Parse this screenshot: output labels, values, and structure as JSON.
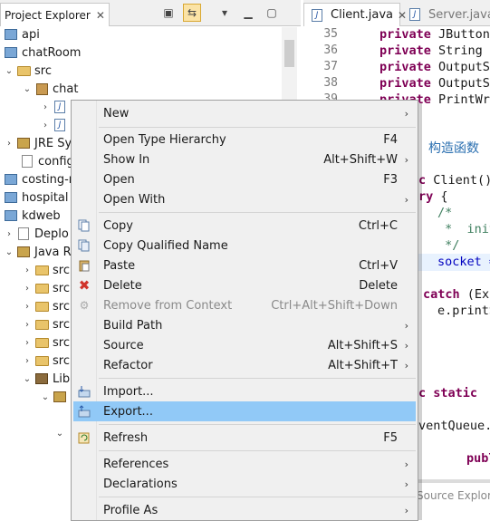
{
  "project_explorer": {
    "title": "Project Explorer",
    "close_glyph": "✕",
    "toolbar_icons": [
      "collapse-all-icon",
      "link-with-editor-icon",
      "view-menu-icon",
      "minimize-icon",
      "maximize-icon"
    ],
    "tree": [
      {
        "label": "api",
        "icon": "project-icon"
      },
      {
        "label": "chatRoom",
        "icon": "project-icon"
      },
      {
        "label": "src",
        "icon": "source-folder-icon"
      },
      {
        "label": "chat",
        "icon": "package-icon"
      },
      {
        "label": "J",
        "icon": "java-file-icon"
      },
      {
        "label": "J",
        "icon": "java-file-icon"
      },
      {
        "label": "JRE Sy",
        "icon": "jre-library-icon"
      },
      {
        "label": "config",
        "icon": "file-icon"
      },
      {
        "label": "costing-m",
        "icon": "project-icon"
      },
      {
        "label": "hospital",
        "icon": "project-icon"
      },
      {
        "label": "kdweb",
        "icon": "project-icon"
      },
      {
        "label": "Deplo",
        "icon": "deployment-icon"
      },
      {
        "label": "Java R",
        "icon": "java-resources-icon"
      },
      {
        "label": "src",
        "icon": "source-folder-icon"
      },
      {
        "label": "src",
        "icon": "source-folder-icon"
      },
      {
        "label": "src",
        "icon": "source-folder-icon"
      },
      {
        "label": "src",
        "icon": "source-folder-icon"
      },
      {
        "label": "src",
        "icon": "source-folder-icon"
      },
      {
        "label": "src",
        "icon": "source-folder-icon"
      },
      {
        "label": "Lib",
        "icon": "library-icon"
      }
    ]
  },
  "editor": {
    "tabs": [
      {
        "label": "Client.java",
        "active": true
      },
      {
        "label": "Server.java",
        "active": false
      }
    ],
    "line_numbers": [
      "35",
      "36",
      "37",
      "38",
      "39"
    ],
    "code": {
      "l35_kw": "private",
      "l35_rest": " JButton",
      "l36_kw": "private",
      "l36_rest": " String ",
      "l37_kw": "private",
      "l37_rest": " OutputS",
      "l38_kw": "private",
      "l38_rest": " OutputS",
      "l39_kw": "private",
      "l39_rest": " PrintWr",
      "comment_cn": "构造函数",
      "client_kw": "c",
      "client_rest": " Client()",
      "try_kw": "ry",
      "try_rest": " {",
      "c1": "/*",
      "c2": " *  init",
      "c3": " */",
      "socket": "socket =",
      "catch_kw": "catch",
      "catch_rest": " (Ex",
      "print": "e.printS",
      "static_kw": "c static",
      "eventqueue": "ventQueue.",
      "publ": "publ"
    },
    "bottom_tab": "Source Explor"
  },
  "context_menu": {
    "items": [
      {
        "label": "New",
        "icon": "",
        "shortcut": "",
        "submenu": true
      },
      {
        "label": "Open Type Hierarchy",
        "icon": "",
        "shortcut": "F4",
        "submenu": false
      },
      {
        "label": "Show In",
        "icon": "",
        "shortcut": "Alt+Shift+W",
        "submenu": true
      },
      {
        "label": "Open",
        "icon": "",
        "shortcut": "F3",
        "submenu": false
      },
      {
        "label": "Open With",
        "icon": "",
        "shortcut": "",
        "submenu": true
      },
      {
        "label": "Copy",
        "icon": "copy-icon",
        "shortcut": "Ctrl+C",
        "submenu": false
      },
      {
        "label": "Copy Qualified Name",
        "icon": "copy-qualified-icon",
        "shortcut": "",
        "submenu": false
      },
      {
        "label": "Paste",
        "icon": "paste-icon",
        "shortcut": "Ctrl+V",
        "submenu": false
      },
      {
        "label": "Delete",
        "icon": "delete-icon",
        "shortcut": "Delete",
        "submenu": false
      },
      {
        "label": "Remove from Context",
        "icon": "remove-context-icon",
        "shortcut": "Ctrl+Alt+Shift+Down",
        "submenu": false,
        "disabled": true
      },
      {
        "label": "Build Path",
        "icon": "",
        "shortcut": "",
        "submenu": true
      },
      {
        "label": "Source",
        "icon": "",
        "shortcut": "Alt+Shift+S",
        "submenu": true
      },
      {
        "label": "Refactor",
        "icon": "",
        "shortcut": "Alt+Shift+T",
        "submenu": true
      },
      {
        "label": "Import...",
        "icon": "import-icon",
        "shortcut": "",
        "submenu": false
      },
      {
        "label": "Export...",
        "icon": "export-icon",
        "shortcut": "",
        "submenu": false,
        "active": true
      },
      {
        "label": "Refresh",
        "icon": "refresh-icon",
        "shortcut": "F5",
        "submenu": false
      },
      {
        "label": "References",
        "icon": "",
        "shortcut": "",
        "submenu": true
      },
      {
        "label": "Declarations",
        "icon": "",
        "shortcut": "",
        "submenu": true
      },
      {
        "label": "Profile As",
        "icon": "",
        "shortcut": "",
        "submenu": true
      }
    ],
    "submenu_glyph": "›"
  },
  "colors": {
    "menu_bg": "#f0f0f0",
    "menu_active": "#91c9f7",
    "keyword": "#7f0055",
    "comment": "#3f7f5f"
  }
}
